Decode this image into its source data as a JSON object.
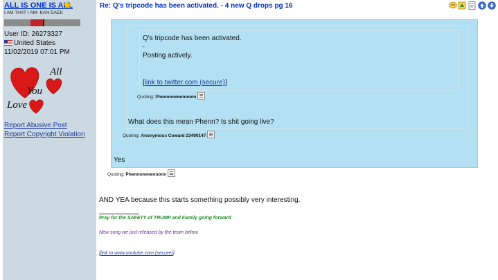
{
  "user": {
    "name": "ALL IS ONE IS ALL",
    "tagline": "I AM THAT I AM- KAN DAEK",
    "id_line": "User ID: 26273327",
    "country": "United States",
    "date": "11/02/2019 07:01 PM",
    "avatar_text": "All You Love",
    "rating_colors": [
      "#8b8b8b",
      "#c0272d",
      "#5a0a0a"
    ]
  },
  "sidebar_links": {
    "report_post": "Report Abusive Post",
    "report_copyright": "Report Copyright Violation"
  },
  "post": {
    "title": "Re: Q's tripcode has been activated. - 4 new Q drops pg 16",
    "icons": [
      "quote-icon",
      "reply-icon",
      "edit-icon",
      "arrow-up-icon",
      "arrow-down-icon"
    ]
  },
  "quotes": {
    "innermost": {
      "line1": "Q's tripcode has been activated.",
      "dash": "-",
      "line2": "Posting actively.",
      "link_open": "[",
      "link_text": "link to twitter.com (secure)",
      "link_close": "]",
      "quoting_prefix": "Quoting: ",
      "quoting_name": "Phennommennonn"
    },
    "middle": {
      "text": "What does this mean Phenn? Is shit going live?",
      "quoting_prefix": "Quoting: ",
      "quoting_name": "Anonymous Coward 23490147"
    },
    "outer": {
      "text": "Yes",
      "quoting_prefix": "Quoting: ",
      "quoting_name": "Phennommennonn"
    }
  },
  "body_text": "AND YEA because this starts something possibly very interesting.",
  "signature": {
    "line1": "Pray for the SAFETY of TRUMP and Family going forward",
    "line2": "New song we just released by the team below.",
    "link_open": "[",
    "link_text": "link to www.youtube.com (secure)",
    "link_close": "]"
  },
  "colors": {
    "sidebar_bg": "#cdd9e2",
    "quote_bg": "#b3e0f2",
    "link_blue": "#0033cc",
    "sig_green": "#1e8f22",
    "sig_purple": "#6f1ea0"
  }
}
